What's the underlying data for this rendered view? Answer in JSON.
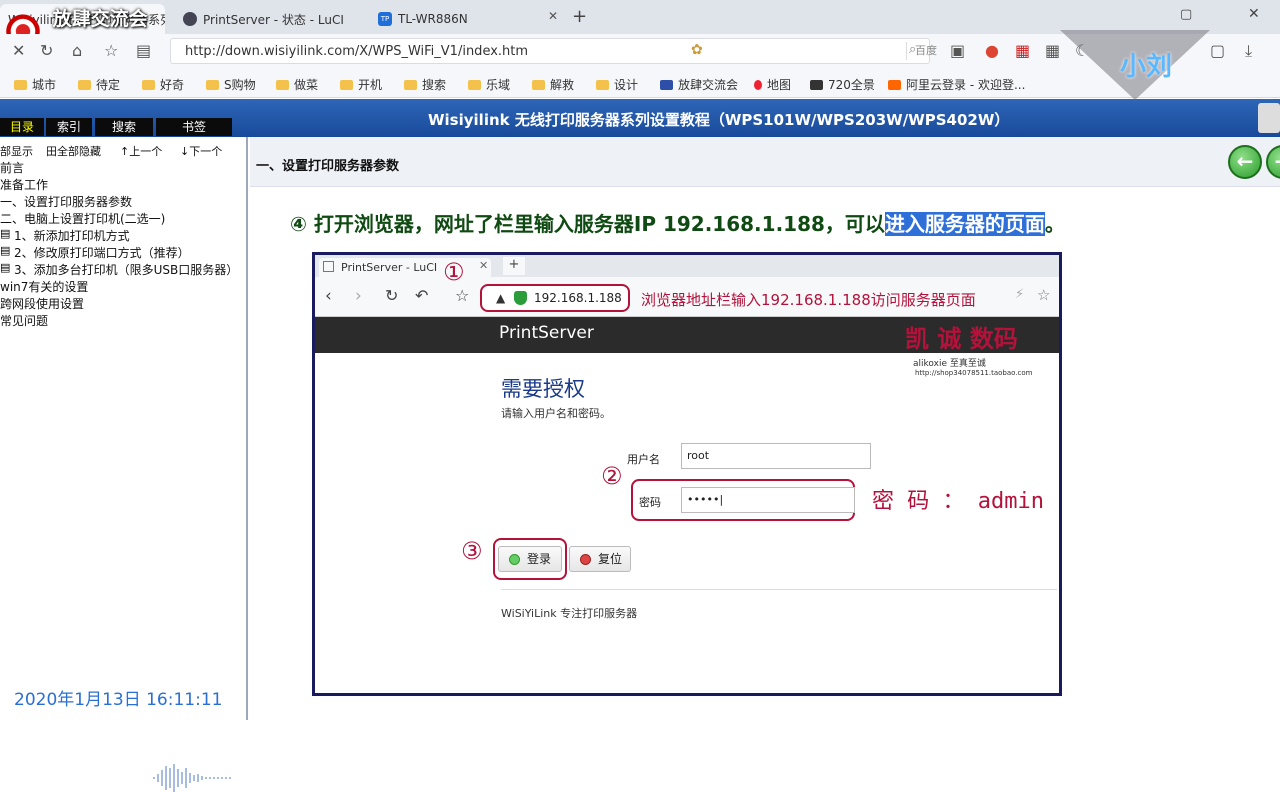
{
  "browser": {
    "tabs": [
      {
        "label": "Wisiyilink无线打印服务器系列设置教程"
      },
      {
        "label": "PrintServer - 状态 - LuCI"
      },
      {
        "label": "TL-WR886N"
      }
    ],
    "new_tab": "+",
    "url": "http://down.wisiyilink.com/X/WPS_WiFi_V1/index.htm",
    "search_placeholder": "百度",
    "bookmarks": [
      "城市",
      "待定",
      "好奇",
      "S购物",
      "做菜",
      "开机",
      "搜索",
      "乐域",
      "解救",
      "设计",
      "放肆交流会",
      "地图",
      "720全景",
      "阿里云登录 - 欢迎登..."
    ]
  },
  "overlay": {
    "logo_text": "放肆交流会",
    "channel_name": "小刘"
  },
  "help": {
    "title": "Wisiyilink 无线打印服务器系列设置教程（WPS101W/WPS203W/WPS402W）",
    "left_tabs": [
      "目录",
      "索引",
      "搜索",
      "书签"
    ],
    "toolbar": [
      "部显示",
      "田全部隐藏",
      "↑上一个",
      "↓下一个"
    ],
    "tree": [
      "前言",
      "准备工作",
      "一、设置打印服务器参数",
      "二、电脑上设置打印机(二选一)",
      "1、新添加打印机方式",
      "2、修改原打印端口方式（推荐）",
      "3、添加多台打印机（限多USB口服务器）",
      "win7有关的设置",
      "跨网段使用设置",
      "常见问题"
    ],
    "datetime": "2020年1月13日 16:11:11",
    "section_title": "一、设置打印服务器参数",
    "step_text": "④ 打开浏览器，网址了栏里输入服务器IP  192.168.1.188，可以",
    "step_highlight": "进入服务器的页面",
    "step_end": "。"
  },
  "screenshot": {
    "tab_label": "PrintServer - LuCI",
    "address": "192.168.1.188",
    "address_annotation": "浏览器地址栏输入192.168.1.188访问服务器页面",
    "brand": "PrintServer",
    "watermark": "凯 诚 数码",
    "watermark_sub": "alikoxie  至真至诚",
    "watermark_url": "http://shop34078511.taobao.com",
    "auth_title": "需要授权",
    "auth_subtitle": "请输入用户名和密码。",
    "username_label": "用户名",
    "username_value": "root",
    "password_label": "密码",
    "password_value": "•••••|",
    "password_annotation": "密 码 ： admin",
    "login_button": "登录",
    "reset_button": "复位",
    "footer": "WiSiYiLink 专注打印服务器",
    "markers": [
      "①",
      "②",
      "③"
    ]
  },
  "colors": {
    "accent_red": "#b3123a",
    "header_blue": "#184a9a",
    "step_green": "#0f4a12",
    "highlight_blue": "#2f6fd8"
  }
}
